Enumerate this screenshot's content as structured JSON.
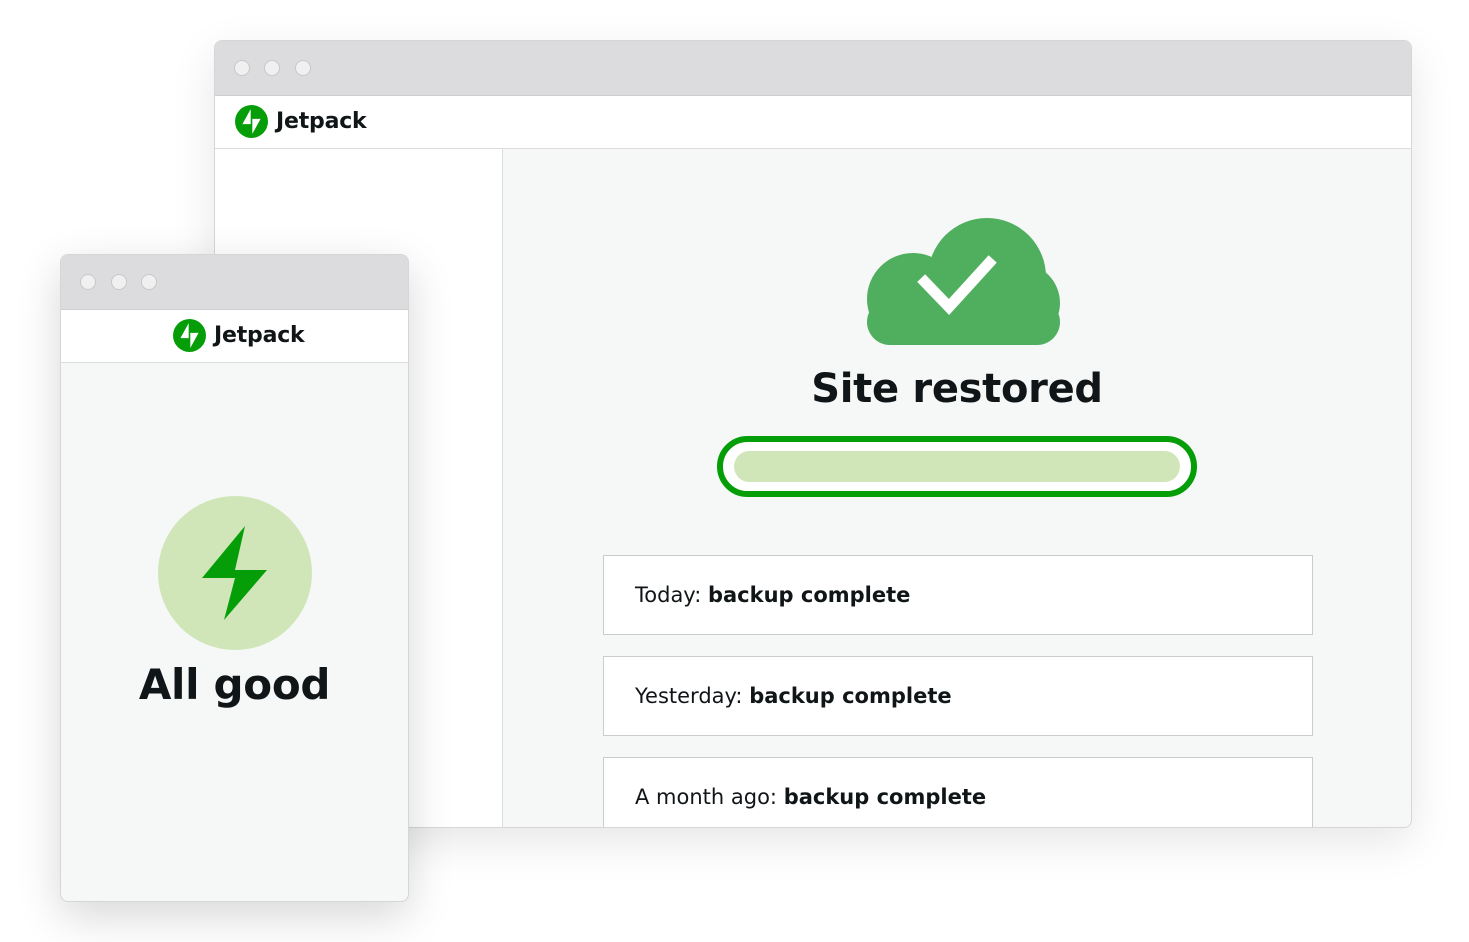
{
  "brand": {
    "name": "Jetpack",
    "accent_color": "#069e08",
    "cloud_color": "#50af5e",
    "light_green": "#d0e6b8"
  },
  "desktop": {
    "logo_text": "Jetpack",
    "title": "Site restored",
    "progress_percent": 100,
    "backups": [
      {
        "when": "Today:",
        "status": "backup complete"
      },
      {
        "when": "Yesterday:",
        "status": "backup complete"
      },
      {
        "when": "A month ago:",
        "status": "backup complete"
      }
    ]
  },
  "mobile": {
    "logo_text": "Jetpack",
    "title": "All good"
  },
  "icons": [
    "jetpack-logo-icon",
    "cloud-check-icon",
    "lightning-bolt-icon"
  ]
}
